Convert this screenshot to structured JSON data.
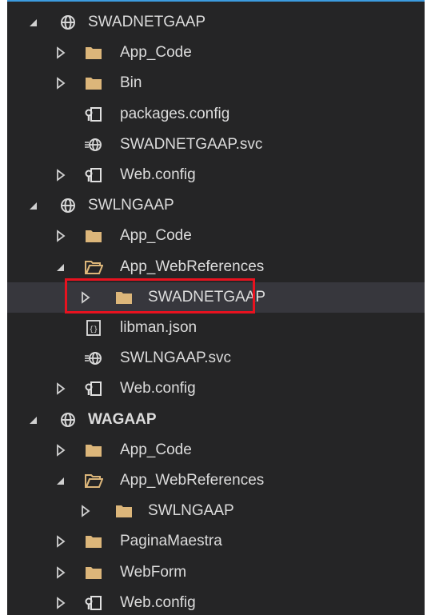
{
  "colors": {
    "background": "#252526",
    "text": "#dcdcdc",
    "folder": "#dcb67a",
    "globe": "#d6d6d6",
    "highlight_box": "#e8121f",
    "accent_top": "#3c9ce0"
  },
  "tree": {
    "items": [
      {
        "label": "SWADNETGAAP",
        "icon": "globe-icon",
        "expanded": true,
        "depth": 0
      },
      {
        "label": "App_Code",
        "icon": "folder-icon",
        "expanded": false,
        "depth": 1
      },
      {
        "label": "Bin",
        "icon": "folder-icon",
        "expanded": false,
        "depth": 1
      },
      {
        "label": "packages.config",
        "icon": "config-file-icon",
        "depth": 1
      },
      {
        "label": "SWADNETGAAP.svc",
        "icon": "service-file-icon",
        "depth": 1
      },
      {
        "label": "Web.config",
        "icon": "config-file-icon",
        "expanded": false,
        "depth": 1
      },
      {
        "label": "SWLNGAAP",
        "icon": "globe-icon",
        "expanded": true,
        "depth": 0
      },
      {
        "label": "App_Code",
        "icon": "folder-icon",
        "expanded": false,
        "depth": 1
      },
      {
        "label": "App_WebReferences",
        "icon": "folder-open-icon",
        "expanded": true,
        "depth": 1
      },
      {
        "label": "SWADNETGAAP",
        "icon": "folder-icon",
        "expanded": false,
        "depth": 2,
        "selected": true
      },
      {
        "label": "libman.json",
        "icon": "json-file-icon",
        "depth": 1
      },
      {
        "label": "SWLNGAAP.svc",
        "icon": "service-file-icon",
        "depth": 1
      },
      {
        "label": "Web.config",
        "icon": "config-file-icon",
        "expanded": false,
        "depth": 1
      },
      {
        "label": "WAGAAP",
        "icon": "globe-icon",
        "expanded": true,
        "depth": 0,
        "bold": true
      },
      {
        "label": "App_Code",
        "icon": "folder-icon",
        "expanded": false,
        "depth": 1
      },
      {
        "label": "App_WebReferences",
        "icon": "folder-open-icon",
        "expanded": true,
        "depth": 1
      },
      {
        "label": "SWLNGAAP",
        "icon": "folder-icon",
        "expanded": false,
        "depth": 2
      },
      {
        "label": "PaginaMaestra",
        "icon": "folder-icon",
        "expanded": false,
        "depth": 1
      },
      {
        "label": "WebForm",
        "icon": "folder-icon",
        "expanded": false,
        "depth": 1
      },
      {
        "label": "Web.config",
        "icon": "config-file-icon",
        "expanded": false,
        "depth": 1
      }
    ]
  }
}
